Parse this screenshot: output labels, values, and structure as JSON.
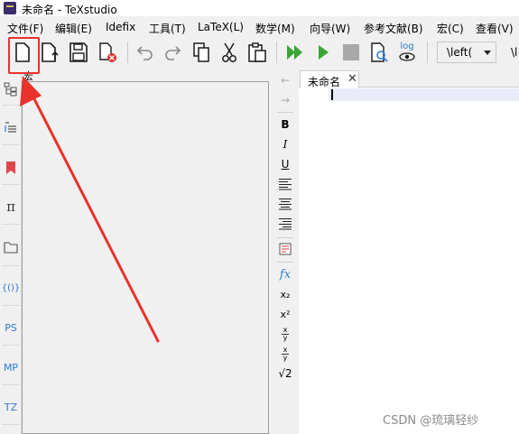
{
  "window": {
    "title": "未命名 - TeXstudio"
  },
  "menu": [
    {
      "label": "文件(F)",
      "name": "menu-file"
    },
    {
      "label": "编辑(E)",
      "name": "menu-edit"
    },
    {
      "label": "Idefix",
      "name": "menu-idefix"
    },
    {
      "label": "工具(T)",
      "name": "menu-tools"
    },
    {
      "label": "LaTeX(L)",
      "name": "menu-latex"
    },
    {
      "label": "数学(M)",
      "name": "menu-math"
    },
    {
      "label": "向导(W)",
      "name": "menu-wizards"
    },
    {
      "label": "参考文献(B)",
      "name": "menu-bibliography"
    },
    {
      "label": "宏(C)",
      "name": "menu-macros"
    },
    {
      "label": "查看(V)",
      "name": "menu-view"
    }
  ],
  "toolbar": {
    "icons": [
      "new-file-icon",
      "open-file-icon",
      "save-icon",
      "close-file-icon",
      "undo-icon",
      "redo-icon",
      "copy-icon",
      "cut-icon",
      "paste-icon",
      "build-and-view-icon",
      "compile-icon",
      "stop-icon",
      "view-pdf-icon",
      "view-log-icon"
    ],
    "log_label": "log",
    "delimiter_value": "\\left(",
    "overflow_text": "\\l"
  },
  "structure_panel": {
    "label": "宏"
  },
  "left_dock": {
    "icons": [
      "structure-tree-icon",
      "todo-list-icon",
      "bookmarks-icon",
      "symbols-pi-icon",
      "files-folder-icon",
      "braces-icon"
    ],
    "pi_glyph": "π",
    "braces_text": "{()}",
    "text_buttons": [
      "PS",
      "MP",
      "TZ"
    ]
  },
  "format_bar": {
    "back_glyph": "←",
    "forward_glyph": "→",
    "bold": "B",
    "italic": "I",
    "underline": "U",
    "fx": "fx",
    "subscript": "x₂",
    "superscript": "x²",
    "frac_num": "x",
    "frac_den": "y",
    "sqrt": "√2"
  },
  "editor": {
    "tab_label": "未命名",
    "tab_close": "✕"
  },
  "watermark": "CSDN @琉璃轻纱",
  "colors": {
    "annotation_red": "#e8322b",
    "accent_green": "#3aa534",
    "icon_blue": "#2a7bd0"
  }
}
